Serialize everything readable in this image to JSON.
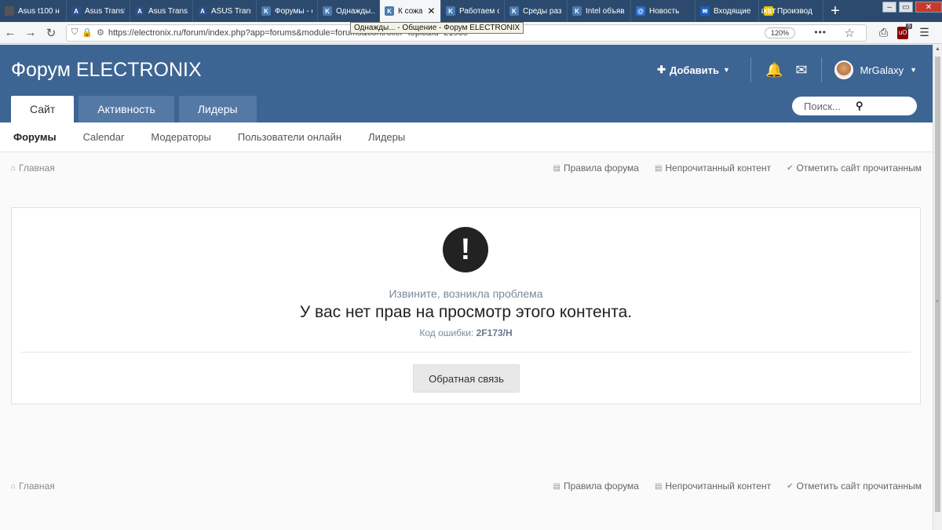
{
  "browser": {
    "tabs": [
      {
        "label": "Asus t100 н",
        "color": "#555555",
        "glyph": ""
      },
      {
        "label": "Asus Transf",
        "color": "#2b4f86",
        "glyph": "A"
      },
      {
        "label": "Asus Transf",
        "color": "#2b4f86",
        "glyph": "A"
      },
      {
        "label": "ASUS Trans",
        "color": "#2b4f86",
        "glyph": "A"
      },
      {
        "label": "Форумы - о",
        "color": "#4a7ab0",
        "glyph": "K"
      },
      {
        "label": "Однажды...",
        "color": "#4a7ab0",
        "glyph": "K"
      },
      {
        "label": "К сожа",
        "color": "#4a7ab0",
        "glyph": "K",
        "active": true
      },
      {
        "label": "Работаем с",
        "color": "#4a7ab0",
        "glyph": "K"
      },
      {
        "label": "Среды раз",
        "color": "#4a7ab0",
        "glyph": "K"
      },
      {
        "label": "Intel объяв",
        "color": "#4a7ab0",
        "glyph": "K"
      },
      {
        "label": "Новость",
        "color": "#2a6fc9",
        "glyph": "@"
      },
      {
        "label": "Входящие",
        "color": "#1a5fc2",
        "glyph": "✉"
      },
      {
        "label": "Производ",
        "color": "#e8c400",
        "glyph": "iXBT"
      }
    ],
    "tab_close": "✕",
    "new_tab": "+",
    "url": "https://electronix.ru/forum/index.php?app=forums&module=forums&controller=topic&id=21938",
    "tooltip": "Однажды... - Общение - Форум ELECTRONIX",
    "zoom": "120%",
    "ublock_count": "5"
  },
  "forum": {
    "logo": "Форум ELECTRONIX",
    "add_button": "Добавить",
    "username": "MrGalaxy",
    "tabs": [
      "Сайт",
      "Активность",
      "Лидеры"
    ],
    "search_placeholder": "Поиск...",
    "subnav": [
      "Форумы",
      "Calendar",
      "Модераторы",
      "Пользователи онлайн",
      "Лидеры"
    ],
    "breadcrumb_home": "Главная",
    "links": {
      "rules": "Правила форума",
      "unread": "Непрочитанный контент",
      "mark_read": "Отметить сайт прочитанным"
    }
  },
  "error": {
    "subtitle": "Извините, возникла проблема",
    "message": "У вас нет прав на просмотр этого контента.",
    "code_label": "Код ошибки:",
    "code": "2F173/H",
    "feedback_button": "Обратная связь"
  }
}
